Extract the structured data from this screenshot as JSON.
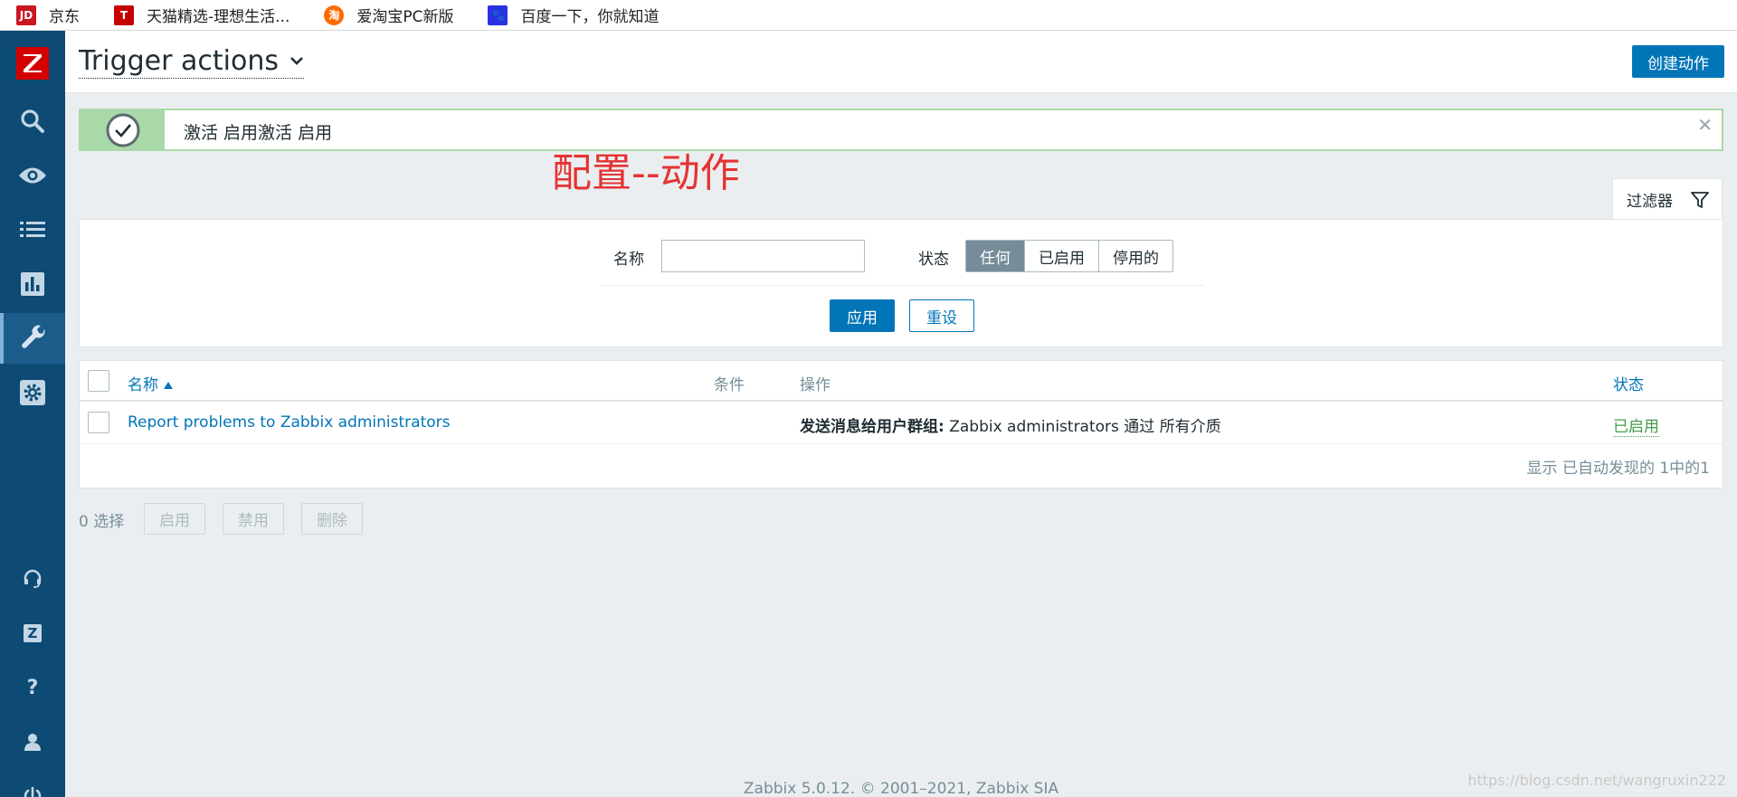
{
  "bookmarks": [
    {
      "label": "京东",
      "icon": "jd-icon",
      "color": "#c81623"
    },
    {
      "label": "天猫精选-理想生活...",
      "icon": "tmall-icon",
      "color": "#c40000"
    },
    {
      "label": "爱淘宝PC新版",
      "icon": "aitaobao-icon",
      "color": "#ff6a00"
    },
    {
      "label": "百度一下，你就知道",
      "icon": "baidu-icon",
      "color": "#2932e1"
    }
  ],
  "sidebar": {
    "logo": "Z",
    "items": [
      "search-icon",
      "monitoring-eye-icon",
      "inventory-list-icon",
      "reports-chart-icon",
      "configuration-wrench-icon",
      "administration-gear-icon"
    ],
    "bottom": [
      "support-headset-icon",
      "zabbix-share-icon",
      "help-icon",
      "user-profile-icon",
      "sign-out-icon"
    ],
    "zshare_label": "Z",
    "help_label": "?"
  },
  "header": {
    "title": "Trigger actions",
    "create_label": "创建动作"
  },
  "message": {
    "text": "激活 启用激活 启用"
  },
  "annotation": "配置--动作",
  "filter": {
    "tab_label": "过滤器",
    "name_label": "名称",
    "name_value": "",
    "status_label": "状态",
    "status_options": [
      "任何",
      "已启用",
      "停用的"
    ],
    "status_selected": "任何",
    "apply_label": "应用",
    "reset_label": "重设"
  },
  "table": {
    "headers": {
      "name": "名称",
      "conditions": "条件",
      "operations": "操作",
      "status": "状态"
    },
    "rows": [
      {
        "name": "Report problems to Zabbix administrators",
        "conditions": "",
        "operation_prefix": "发送消息给用户群组:",
        "operation_text": "Zabbix administrators 通过 所有介质",
        "status": "已启用"
      }
    ],
    "paging": "显示 已自动发现的 1中的1"
  },
  "mass_actions": {
    "selected": "0 选择",
    "enable": "启用",
    "disable": "禁用",
    "delete": "删除"
  },
  "footer": "Zabbix 5.0.12. © 2001–2021, Zabbix SIA",
  "watermark": "https://blog.csdn.net/wangruxin222",
  "colors": {
    "sidebar": "#0d4a74",
    "primary": "#0275b8",
    "success": "#a9d9a9",
    "enabled": "#429e47",
    "annotation": "#e53333"
  }
}
